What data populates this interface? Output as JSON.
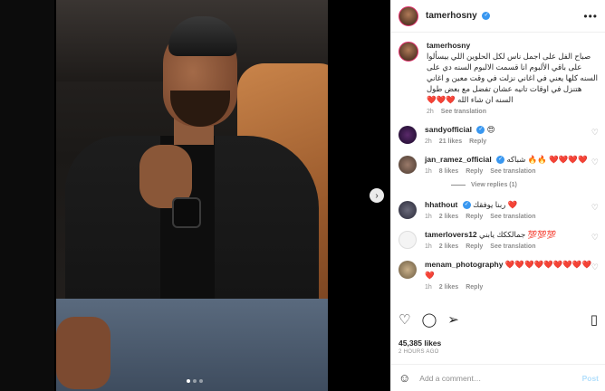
{
  "header": {
    "username": "tamerhosny",
    "verified": true
  },
  "caption": {
    "username": "tamerhosny",
    "text": "صباح الفل على اجمل ناس لكل الحلوين اللي بيسألوا على باقي الألبوم انا قسمت الالبوم السنه دي على السنه كلها يعني في اغاني نزلت في وقت معين و اغاني هتنزل في اوقات تانيه عشان تفضل مع بعض طول السنه ان شاء الله ❤️❤️❤️",
    "time": "2h",
    "see_translation": "See translation"
  },
  "comments": [
    {
      "username": "sandyofficial",
      "verified": true,
      "text": "😍",
      "time": "2h",
      "likes": "21 likes",
      "reply": "Reply",
      "translation": ""
    },
    {
      "username": "jan_ramez_official",
      "verified": true,
      "text": "شباكه 🔥🔥 ❤️❤️❤️❤️",
      "time": "1h",
      "likes": "8 likes",
      "reply": "Reply",
      "translation": "See translation"
    },
    {
      "username": "hhathout",
      "verified": true,
      "text": "ربنا يوفقك ❤️",
      "time": "1h",
      "likes": "2 likes",
      "reply": "Reply",
      "translation": "See translation"
    },
    {
      "username": "tamerlovers12",
      "verified": false,
      "text": "جمالككك يابني 💯💯💯",
      "time": "1h",
      "likes": "2 likes",
      "reply": "Reply",
      "translation": "See translation"
    },
    {
      "username": "menam_photography",
      "verified": false,
      "text": "❤️❤️❤️❤️❤️❤️❤️❤️❤️❤️",
      "time": "1h",
      "likes": "2 likes",
      "reply": "Reply",
      "translation": ""
    }
  ],
  "view_replies": "View replies (1)",
  "actions": {
    "like_icon": "heart-icon",
    "comment_icon": "comment-icon",
    "share_icon": "share-icon",
    "save_icon": "bookmark-icon"
  },
  "likes": "45,385 likes",
  "time_ago": "2 HOURS AGO",
  "add_comment": {
    "placeholder": "Add a comment…",
    "post_label": "Post"
  },
  "colors": {
    "link_blue": "#3897f0",
    "like_red": "#ed4956",
    "post_disabled": "#b2dffc"
  }
}
